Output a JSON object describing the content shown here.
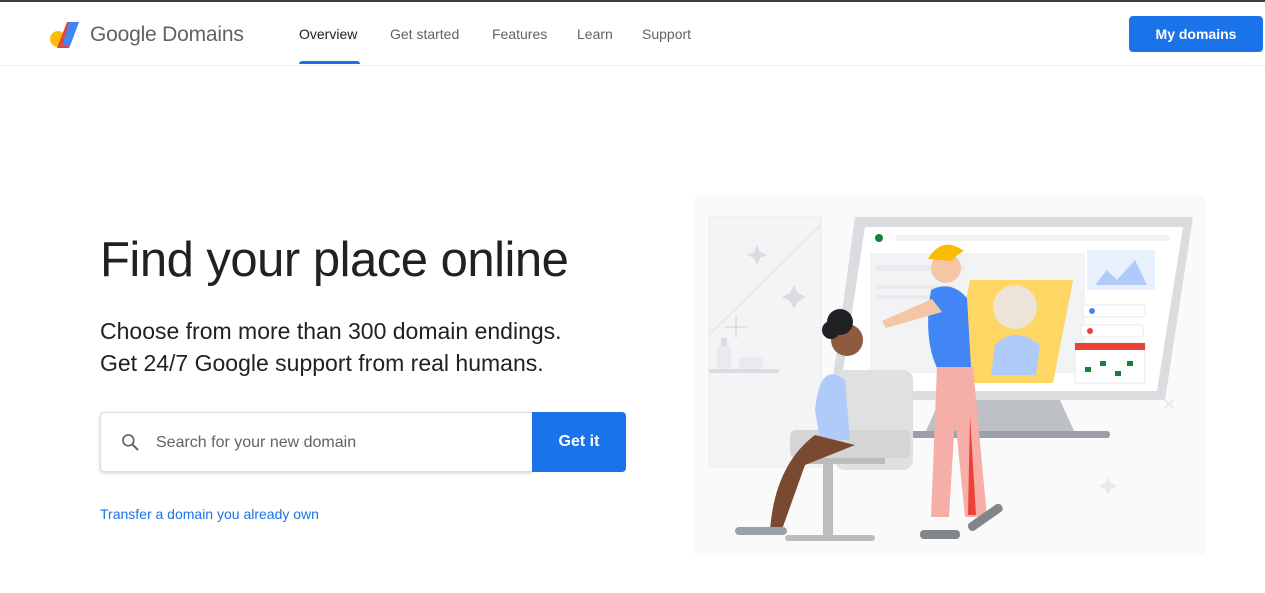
{
  "brand": {
    "name": "Google Domains"
  },
  "nav": {
    "items": [
      {
        "label": "Overview",
        "active": true
      },
      {
        "label": "Get started",
        "active": false
      },
      {
        "label": "Features",
        "active": false
      },
      {
        "label": "Learn",
        "active": false
      },
      {
        "label": "Support",
        "active": false
      }
    ]
  },
  "header": {
    "my_domains_label": "My domains"
  },
  "hero": {
    "title": "Find your place online",
    "subtitle_line1": "Choose from more than 300 domain endings.",
    "subtitle_line2": "Get 24/7 Google support from real humans."
  },
  "search": {
    "placeholder": "Search for your new domain",
    "value": "",
    "button_label": "Get it",
    "icon": "search-icon"
  },
  "transfer": {
    "link_text": "Transfer a domain you already own"
  },
  "colors": {
    "accent": "#1a73e8",
    "text_primary": "#202124",
    "text_secondary": "#5f6368",
    "logo_yellow": "#fbbc04",
    "logo_blue": "#4285f4",
    "logo_orange": "#ea4335"
  }
}
